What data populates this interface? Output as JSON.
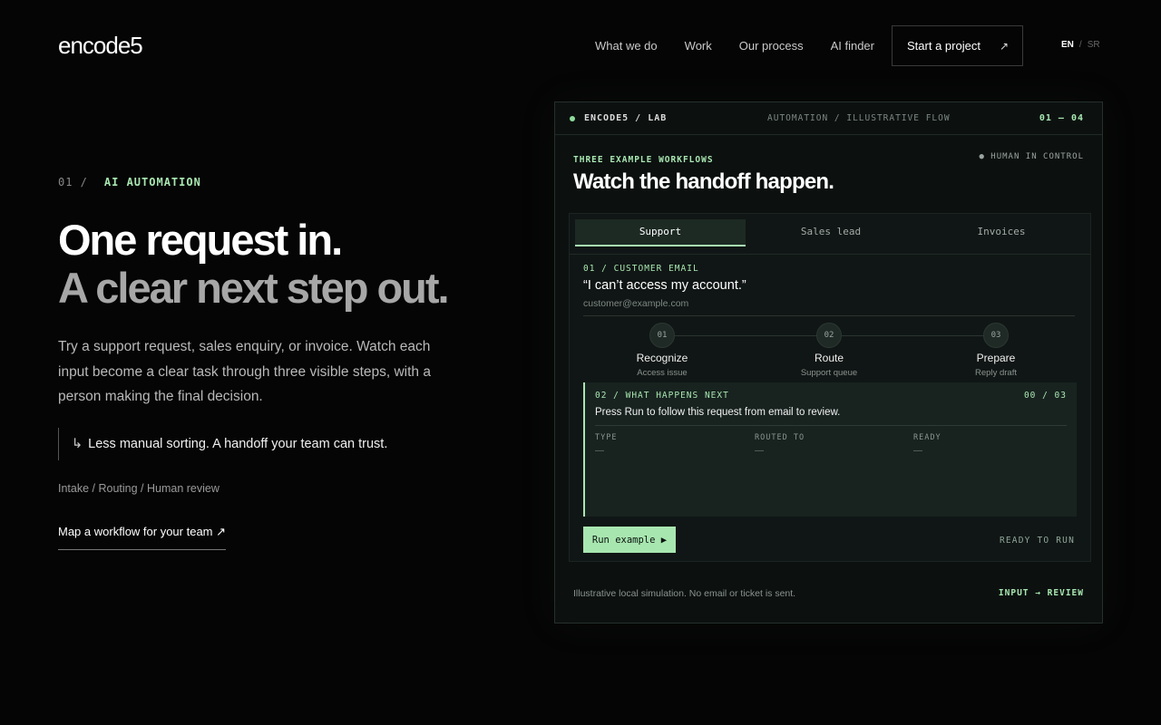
{
  "header": {
    "logo": "encode5",
    "nav": [
      "What we do",
      "Work",
      "Our process",
      "AI finder"
    ],
    "cta_label": "Start a project",
    "cta_arrow": "↗",
    "lang_active": "EN",
    "lang_sep": "/",
    "lang_other": "SR"
  },
  "hero": {
    "eyebrow_num": "01 /",
    "eyebrow_label": "AI AUTOMATION",
    "title_line1": "One request in.",
    "title_line2": "A clear next step out.",
    "lead": "Try a support request, sales enquiry, or invoice. Watch each input become a clear task through three visible steps, with a person making the final decision.",
    "quote_glyph": "↳",
    "quote": "Less manual sorting. A handoff your team can trust.",
    "tags": "Intake / Routing / Human review",
    "link": "Map a workflow for your team ↗"
  },
  "panel": {
    "top_left": "ENCODE5 / LAB",
    "top_mid": "AUTOMATION / ILLUSTRATIVE FLOW",
    "top_right": "01 — 04",
    "eyebrow": "THREE EXAMPLE WORKFLOWS",
    "control": "● HUMAN IN CONTROL",
    "title": "Watch the handoff happen.",
    "tabs": [
      "Support",
      "Sales lead",
      "Invoices"
    ],
    "email_label": "01 / CUSTOMER EMAIL",
    "email_quote": "“I can’t access my account.”",
    "email_from": "customer@example.com",
    "steps": [
      {
        "num": "01",
        "name": "Recognize",
        "sub": "Access issue"
      },
      {
        "num": "02",
        "name": "Route",
        "sub": "Support queue"
      },
      {
        "num": "03",
        "name": "Prepare",
        "sub": "Reply draft"
      }
    ],
    "next_label": "02 / WHAT HAPPENS NEXT",
    "next_count": "00 / 03",
    "next_msg": "Press Run to follow this request from email to review.",
    "cols": [
      {
        "label": "TYPE",
        "value": "—"
      },
      {
        "label": "ROUTED TO",
        "value": "—"
      },
      {
        "label": "READY",
        "value": "—"
      }
    ],
    "run_label": "Run example ▶",
    "ready": "READY TO RUN",
    "footnote": "Illustrative local simulation. No email or ticket is sent.",
    "flow": "INPUT → REVIEW"
  }
}
